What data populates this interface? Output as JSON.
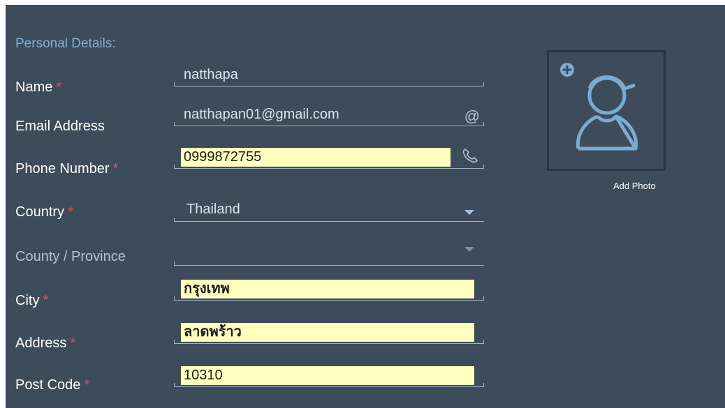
{
  "section_title": "Personal Details:",
  "required_marker": "*",
  "fields": {
    "name": {
      "label": "Name",
      "value": "natthapa"
    },
    "email": {
      "label": "Email Address",
      "value": "natthapan01@gmail.com",
      "icon": "at-icon"
    },
    "phone": {
      "label": "Phone Number",
      "value": "0999872755",
      "icon": "phone-icon"
    },
    "country": {
      "label": "Country",
      "value": "Thailand"
    },
    "province": {
      "label": "County / Province",
      "value": ""
    },
    "city": {
      "label": "City",
      "value": "กรุงเทพ"
    },
    "address": {
      "label": "Address",
      "value": "ลาดพร้าว"
    },
    "postcode": {
      "label": "Post Code",
      "value": "10310"
    }
  },
  "photo": {
    "label": "Add Photo",
    "add_icon": "plus-circle-icon",
    "avatar_icon": "user-avatar-icon"
  },
  "colors": {
    "panel_bg": "#3e4b5b",
    "section_title": "#7fb1d8",
    "required": "#e0534a",
    "highlight": "#ffffbf",
    "accent_blue": "#78acd4"
  }
}
